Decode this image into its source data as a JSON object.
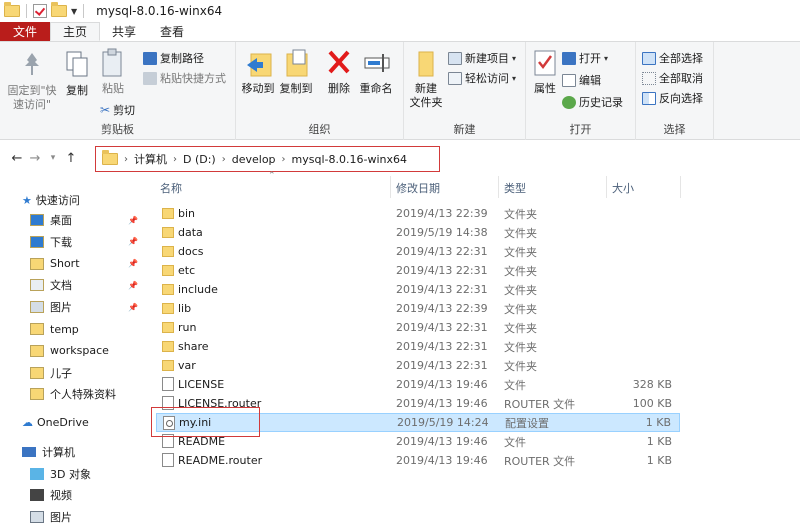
{
  "window": {
    "title": "mysql-8.0.16-winx64"
  },
  "tabs": [
    {
      "label": "文件"
    },
    {
      "label": "主页"
    },
    {
      "label": "共享"
    },
    {
      "label": "查看"
    }
  ],
  "ribbon": {
    "clipboard": {
      "label": "剪贴板",
      "pin_quick": "固定到\"快\n速访问\"",
      "copy": "复制",
      "paste": "粘贴",
      "copy_path": "复制路径",
      "paste_shortcut": "粘贴快捷方式",
      "cut": "剪切"
    },
    "organize": {
      "label": "组织",
      "move_to": "移动到",
      "copy_to": "复制到",
      "delete": "删除",
      "rename": "重命名"
    },
    "new": {
      "label": "新建",
      "new_folder": "新建\n文件夹",
      "new_item": "新建项目",
      "easy_access": "轻松访问"
    },
    "open": {
      "label": "打开",
      "properties": "属性",
      "open": "打开",
      "edit": "编辑",
      "history": "历史记录"
    },
    "select": {
      "label": "选择",
      "select_all": "全部选择",
      "select_none": "全部取消",
      "invert": "反向选择"
    }
  },
  "address": {
    "crumbs": [
      "计算机",
      "D (D:)",
      "develop",
      "mysql-8.0.16-winx64"
    ]
  },
  "nav": {
    "quick_access": "快速访问",
    "items": [
      {
        "label": "桌面",
        "pinned": true
      },
      {
        "label": "下载",
        "pinned": true
      },
      {
        "label": "Short",
        "pinned": true
      },
      {
        "label": "文档",
        "pinned": true
      },
      {
        "label": "图片",
        "pinned": true
      },
      {
        "label": "temp",
        "pinned": false
      },
      {
        "label": "workspace",
        "pinned": false
      },
      {
        "label": "儿子",
        "pinned": false
      },
      {
        "label": "个人特殊资料",
        "pinned": false
      }
    ],
    "onedrive": "OneDrive",
    "computer": "计算机",
    "computer_items": [
      "3D 对象",
      "视频",
      "图片"
    ]
  },
  "columns": {
    "name": "名称",
    "date": "修改日期",
    "type": "类型",
    "size": "大小"
  },
  "files": [
    {
      "name": "bin",
      "date": "2019/4/13 22:39",
      "type": "文件夹",
      "size": "",
      "kind": "folder"
    },
    {
      "name": "data",
      "date": "2019/5/19 14:38",
      "type": "文件夹",
      "size": "",
      "kind": "folder"
    },
    {
      "name": "docs",
      "date": "2019/4/13 22:31",
      "type": "文件夹",
      "size": "",
      "kind": "folder"
    },
    {
      "name": "etc",
      "date": "2019/4/13 22:31",
      "type": "文件夹",
      "size": "",
      "kind": "folder"
    },
    {
      "name": "include",
      "date": "2019/4/13 22:31",
      "type": "文件夹",
      "size": "",
      "kind": "folder"
    },
    {
      "name": "lib",
      "date": "2019/4/13 22:39",
      "type": "文件夹",
      "size": "",
      "kind": "folder"
    },
    {
      "name": "run",
      "date": "2019/4/13 22:31",
      "type": "文件夹",
      "size": "",
      "kind": "folder"
    },
    {
      "name": "share",
      "date": "2019/4/13 22:31",
      "type": "文件夹",
      "size": "",
      "kind": "folder"
    },
    {
      "name": "var",
      "date": "2019/4/13 22:31",
      "type": "文件夹",
      "size": "",
      "kind": "folder"
    },
    {
      "name": "LICENSE",
      "date": "2019/4/13 19:46",
      "type": "文件",
      "size": "328 KB",
      "kind": "file"
    },
    {
      "name": "LICENSE.router",
      "date": "2019/4/13 19:46",
      "type": "ROUTER 文件",
      "size": "100 KB",
      "kind": "file"
    },
    {
      "name": "my.ini",
      "date": "2019/5/19 14:24",
      "type": "配置设置",
      "size": "1 KB",
      "kind": "ini",
      "selected": true
    },
    {
      "name": "README",
      "date": "2019/4/13 19:46",
      "type": "文件",
      "size": "1 KB",
      "kind": "file"
    },
    {
      "name": "README.router",
      "date": "2019/4/13 19:46",
      "type": "ROUTER 文件",
      "size": "1 KB",
      "kind": "file"
    }
  ]
}
